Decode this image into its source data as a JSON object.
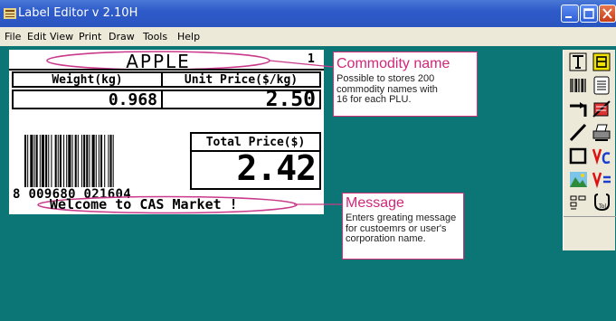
{
  "window": {
    "title": "Label Editor v 2.10H"
  },
  "menu": [
    "File",
    "Edit",
    "View",
    "Print",
    "Draw",
    "Tools",
    "Help"
  ],
  "label": {
    "commodity": "APPLE",
    "plu_index": "1",
    "weight_header": "Weight(kg)",
    "unit_price_header": "Unit Price($/kg)",
    "weight_value": "0.968",
    "unit_price_value": "2.50",
    "total_price_header": "Total Price($)",
    "total_price_value": "2.42",
    "barcode_digits": "8 009680 021604",
    "message": "Welcome to CAS Market !"
  },
  "callouts": {
    "commodity": {
      "title": "Commodity name",
      "text": "Possible to stores 200\ncommodity names with\n16 for each PLU."
    },
    "message": {
      "title": "Message",
      "text": "Enters greating message\nfor custoemrs or user's\ncorporation name."
    }
  },
  "toolbox": {
    "tools": [
      "text-tool-icon",
      "field-tool-icon",
      "barcode-tool-icon",
      "list-tool-icon",
      "move-tool-icon",
      "erase-tool-icon",
      "line-tool-icon",
      "print-tool-icon",
      "rectangle-tool-icon",
      "variable-c-tool-icon",
      "image-tool-icon",
      "variable-equals-tool-icon",
      "layout-tool-icon",
      "settings-tool-icon"
    ]
  },
  "colors": {
    "titlebar": "#2e5bc9",
    "workspace": "#0c7575",
    "callout_accent": "#d6327a"
  }
}
